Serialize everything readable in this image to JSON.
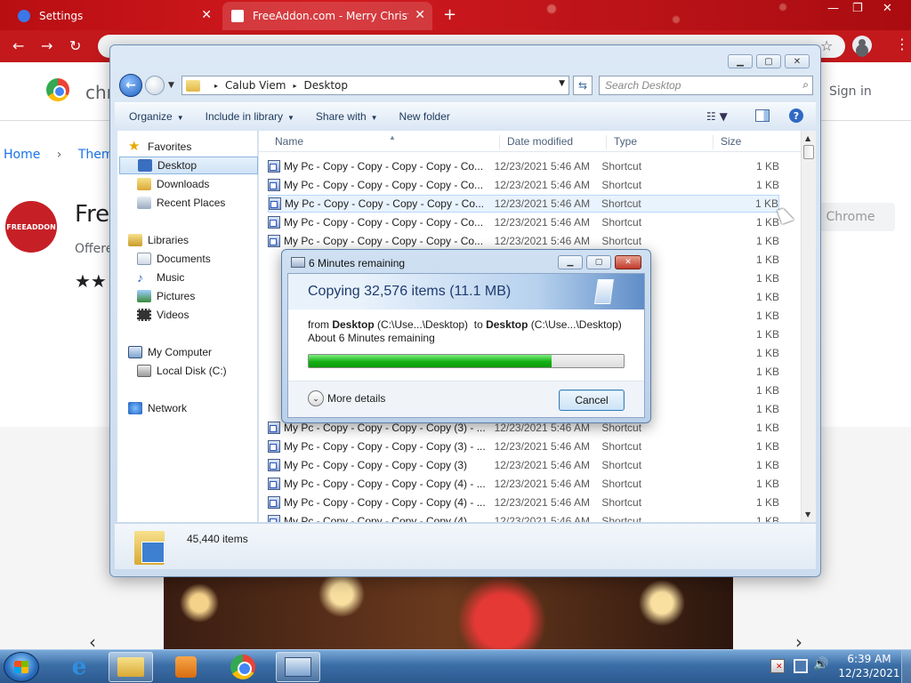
{
  "browser": {
    "tabs": [
      {
        "label": "Settings"
      },
      {
        "label": "FreeAddon.com - Merry Christmas"
      }
    ],
    "new_tab": "+",
    "window_controls": {
      "minimize": "—",
      "maximize": "❐",
      "close": "✕"
    }
  },
  "store": {
    "name": "chr",
    "signin": "Sign in",
    "breadcrumb": [
      "Home",
      "›",
      "Themes"
    ],
    "ext_logo_text": "FREEADDON",
    "ext_title": "Fre",
    "offered": "Offere",
    "stars": "★★",
    "add_button": "Chrome"
  },
  "explorer": {
    "address": {
      "segments": [
        "Calub Viem",
        "Desktop"
      ],
      "separator": "▸"
    },
    "search_placeholder": "Search Desktop",
    "commands": [
      "Organize",
      "Include in library",
      "Share with",
      "New folder"
    ],
    "nav": {
      "favorites": "Favorites",
      "desktop": "Desktop",
      "downloads": "Downloads",
      "recent_places": "Recent Places",
      "libraries": "Libraries",
      "documents": "Documents",
      "music": "Music",
      "pictures": "Pictures",
      "videos": "Videos",
      "my_computer": "My Computer",
      "local_disk": "Local Disk (C:)",
      "network": "Network"
    },
    "columns": {
      "name": "Name",
      "date": "Date modified",
      "type": "Type",
      "size": "Size"
    },
    "files": [
      {
        "name": "My Pc - Copy - Copy - Copy - Copy - Co...",
        "date": "12/23/2021 5:46 AM",
        "type": "Shortcut",
        "size": "1 KB"
      },
      {
        "name": "My Pc - Copy - Copy - Copy - Copy - Co...",
        "date": "12/23/2021 5:46 AM",
        "type": "Shortcut",
        "size": "1 KB"
      },
      {
        "name": "My Pc - Copy - Copy - Copy - Copy - Co...",
        "date": "12/23/2021 5:46 AM",
        "type": "Shortcut",
        "size": "1 KB"
      },
      {
        "name": "My Pc - Copy - Copy - Copy - Copy - Co...",
        "date": "12/23/2021 5:46 AM",
        "type": "Shortcut",
        "size": "1 KB"
      },
      {
        "name": "My Pc - Copy - Copy - Copy - Copy - Co...",
        "date": "12/23/2021 5:46 AM",
        "type": "Shortcut",
        "size": "1 KB"
      },
      {
        "name": "",
        "date": "",
        "type": "",
        "size": "1 KB"
      },
      {
        "name": "",
        "date": "",
        "type": "",
        "size": "1 KB"
      },
      {
        "name": "",
        "date": "",
        "type": "",
        "size": "1 KB"
      },
      {
        "name": "",
        "date": "",
        "type": "",
        "size": "1 KB"
      },
      {
        "name": "",
        "date": "",
        "type": "",
        "size": "1 KB"
      },
      {
        "name": "",
        "date": "",
        "type": "",
        "size": "1 KB"
      },
      {
        "name": "",
        "date": "",
        "type": "",
        "size": "1 KB"
      },
      {
        "name": "",
        "date": "",
        "type": "",
        "size": "1 KB"
      },
      {
        "name": "",
        "date": "",
        "type": "",
        "size": "1 KB"
      },
      {
        "name": "My Pc - Copy - Copy - Copy - Copy (3) - ...",
        "date": "12/23/2021 5:46 AM",
        "type": "Shortcut",
        "size": "1 KB"
      },
      {
        "name": "My Pc - Copy - Copy - Copy - Copy (3) - ...",
        "date": "12/23/2021 5:46 AM",
        "type": "Shortcut",
        "size": "1 KB"
      },
      {
        "name": "My Pc - Copy - Copy - Copy - Copy (3)",
        "date": "12/23/2021 5:46 AM",
        "type": "Shortcut",
        "size": "1 KB"
      },
      {
        "name": "My Pc - Copy - Copy - Copy - Copy (4) - ...",
        "date": "12/23/2021 5:46 AM",
        "type": "Shortcut",
        "size": "1 KB"
      },
      {
        "name": "My Pc - Copy - Copy - Copy - Copy (4) - ...",
        "date": "12/23/2021 5:46 AM",
        "type": "Shortcut",
        "size": "1 KB"
      },
      {
        "name": "My Pc - Copy - Copy - Copy - Copy (4) ...",
        "date": "12/23/2021 5:46 AM",
        "type": "Shortcut",
        "size": "1 KB"
      }
    ],
    "item_count": "45,440 items"
  },
  "copy_dialog": {
    "title": "6 Minutes remaining",
    "header": "Copying 32,576 items (11.1 MB)",
    "from_word": "from",
    "from_name": "Desktop",
    "from_path": "(C:\\Use...\\Desktop)",
    "to_word": "to",
    "to_name": "Desktop",
    "to_path": "(C:\\Use...\\Desktop)",
    "remaining": "About 6 Minutes remaining",
    "progress": 0.77,
    "progress_color": "#14b014",
    "more_details": "More details",
    "cancel": "Cancel"
  },
  "taskbar": {
    "time": "6:39 AM",
    "date": "12/23/2021",
    "ie_glyph": "e",
    "volume_glyph": "🔊"
  }
}
